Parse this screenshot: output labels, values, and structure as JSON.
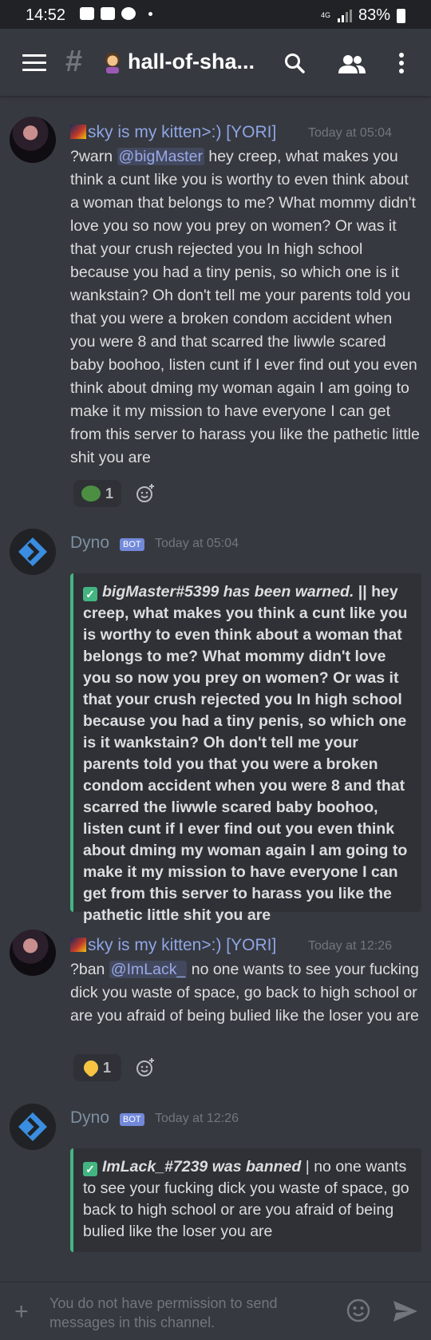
{
  "status_bar": {
    "time": "14:52",
    "network": "4G",
    "battery": "83%"
  },
  "header": {
    "channel": "hall-of-sha..."
  },
  "messages": [
    {
      "author": "sky is my kitten>:) [YORI]",
      "timestamp": "Today at 05:04",
      "pre": "?warn ",
      "mention": "@bigMaster",
      "text": " hey creep, what makes you think a cunt like you is worthy to even think about a woman that belongs to me? What mommy didn't love you so now you prey on women? Or was it that your crush rejected you In high school because you had a tiny penis, so which one is it wankstain? Oh don't tell me your parents told you that you were a broken condom accident when you were 8 and that scarred the liwwle scared baby boohoo, listen cunt if I ever find out you even think about dming my woman again I am going to make it my mission to have everyone I can get from this server to harass you like the pathetic little shit you are",
      "reaction_count": "1"
    },
    {
      "author": "Dyno",
      "bot_tag": "BOT",
      "timestamp": "Today at 05:04",
      "embed_head": "bigMaster#5399 has been warned.",
      "embed_text": " || hey creep, what makes you think a cunt like you is worthy to even think about a woman that belongs to me? What mommy didn't love you so now you prey on women? Or was it that your crush rejected you In high school because you had a tiny penis, so which one is it wankstain? Oh don't tell me your parents told you that you were a broken condom accident when you were 8 and that scarred the liwwle scared baby boohoo, listen cunt if I ever find out you even think about dming my woman again I am going to make it my mission to have everyone I can get from this server to harass you like the pathetic little shit you are"
    },
    {
      "author": "sky is my kitten>:) [YORI]",
      "timestamp": "Today at 12:26",
      "pre": "?ban ",
      "mention": "@ImLack_",
      "text": " no one wants to see your fucking dick you waste of space, go back to high school or are you afraid of being bulied like the loser you are",
      "reaction_count": "1"
    },
    {
      "author": "Dyno",
      "bot_tag": "BOT",
      "timestamp": "Today at 12:26",
      "embed_head": "ImLack_#7239 was banned",
      "embed_text": " | no one wants to see your fucking dick you waste of space, go back to high school or are you afraid of being bulied like the loser you are"
    }
  ],
  "composer": {
    "placeholder": "You do not have permission to send messages in this channel."
  },
  "colors": {
    "background": "#36393f",
    "embed_accent": "#43b581",
    "mention": "#9aa9e6",
    "bot_badge": "#7289da"
  }
}
